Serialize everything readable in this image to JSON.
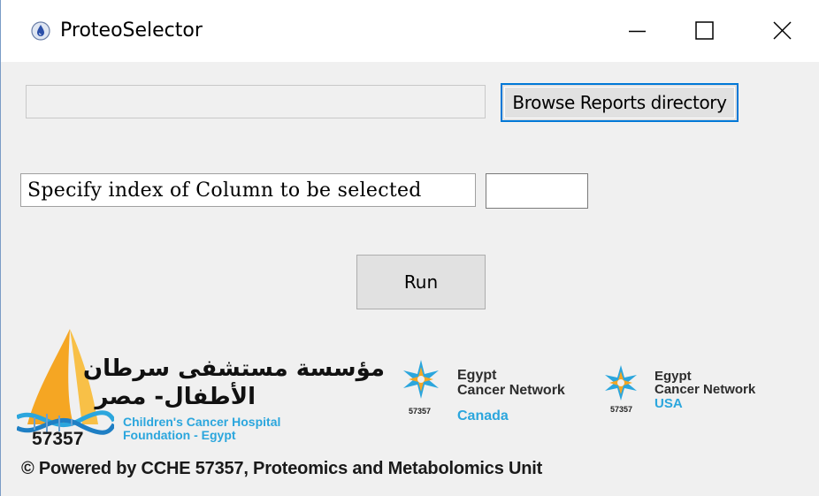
{
  "window": {
    "title": "ProteoSelector",
    "icon": "app-droplet-icon",
    "controls": {
      "minimize": "minimize-icon",
      "maximize": "maximize-icon",
      "close": "close-icon"
    }
  },
  "browse": {
    "path_value": "",
    "button_label": "Browse Reports directory"
  },
  "column": {
    "label": "Specify index of Column to be selected",
    "value": ""
  },
  "run": {
    "label": "Run"
  },
  "logos": {
    "cche": {
      "number": "57357",
      "arabic_line1": "مؤسسة مستشفى سرطان",
      "arabic_line2": "الأطفال- مصر",
      "english_line1": "Children's Cancer Hospital",
      "english_line2": "Foundation - Egypt"
    },
    "ecn_canada": {
      "number": "57357",
      "line1": "Egypt",
      "line2": "Cancer Network",
      "country": "Canada"
    },
    "ecn_usa": {
      "number": "57357",
      "line1": "Egypt",
      "line2": "Cancer Network",
      "country": "USA"
    }
  },
  "footer": {
    "text": "© Powered by CCHE 57357, Proteomics and Metabolomics Unit"
  },
  "colors": {
    "accent": "#0078d7",
    "brand_blue": "#2ba6dd",
    "brand_orange": "#f5a623",
    "window_bg": "#f0f0f0"
  }
}
